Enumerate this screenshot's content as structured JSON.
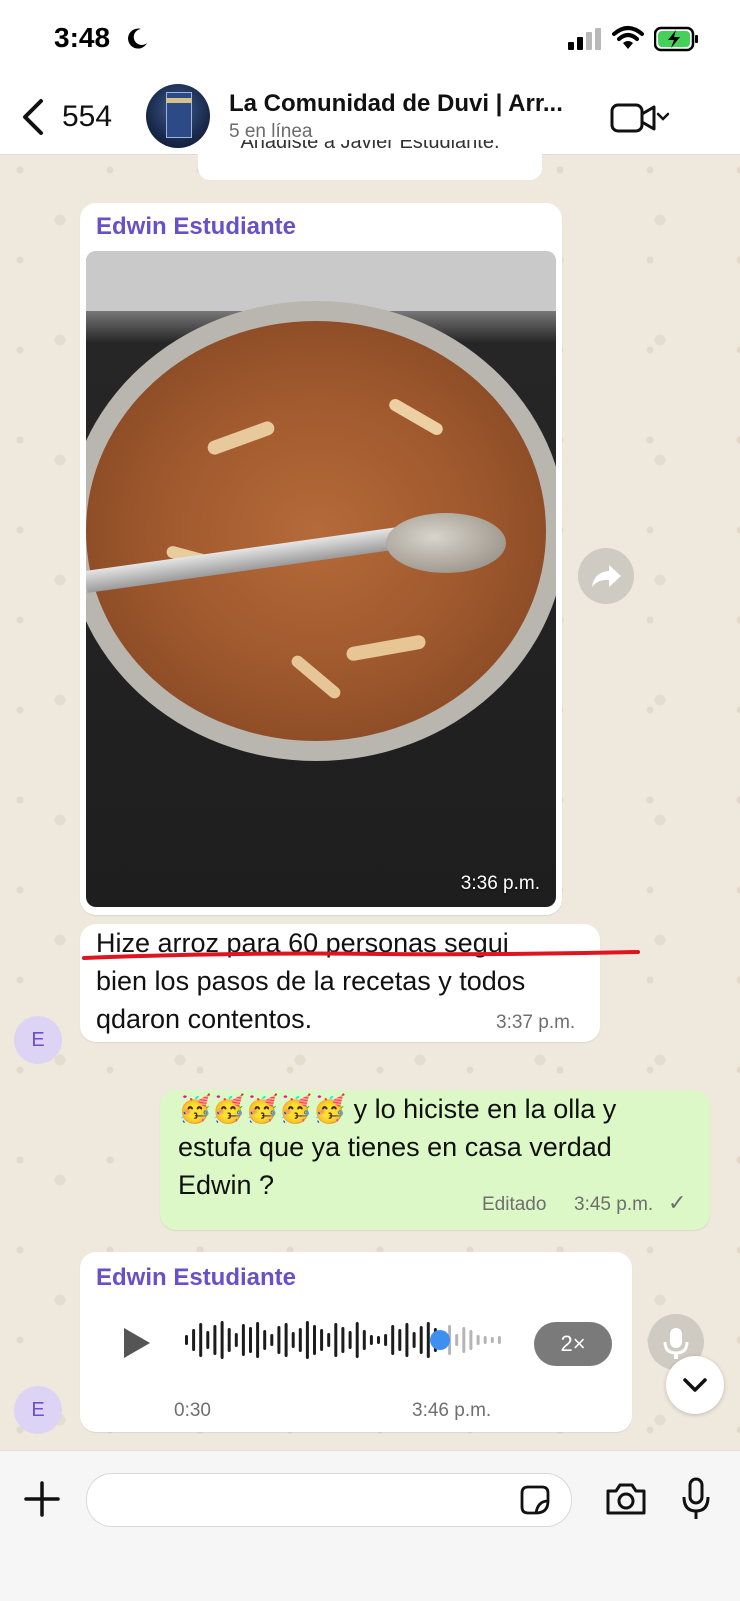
{
  "status_bar": {
    "time": "3:48"
  },
  "header": {
    "back_count": "554",
    "title": "La Comunidad de Duvi | Arr...",
    "subtitle": "5 en línea"
  },
  "system_notice": "Añadiste a Javier Estudiante.",
  "messages": {
    "photo_msg": {
      "sender": "Edwin Estudiante",
      "time": "3:36 p.m."
    },
    "text_msg": {
      "line1": "Hize arroz para 60  personas segui",
      "line2": "bien los pasos de la recetas y todos",
      "line3": "qdaron contentos.",
      "time": "3:37 p.m.",
      "avatar_initial": "E"
    },
    "outgoing": {
      "line1": "🥳🥳🥳🥳🥳 y lo hiciste en la olla y",
      "line2": "estufa que ya tienes en casa verdad",
      "line3": "Edwin ?",
      "edited": "Editado",
      "time": "3:45 p.m.",
      "check": "✓"
    },
    "voice": {
      "sender": "Edwin Estudiante",
      "duration": "0:30",
      "time": "3:46 p.m.",
      "speed": "2×",
      "progress": 0.82,
      "avatar_initial": "E"
    }
  },
  "colors": {
    "sender_name": "#6a50c7",
    "outgoing_bubble": "#dcf8c6",
    "highlight_line": "#e0141e",
    "waveform_played": "#1c1c1c",
    "waveform_unplayed": "#b5b5b5",
    "waveform_thumb": "#3d8ff0"
  },
  "icons": [
    "moon-icon",
    "signal-icon",
    "wifi-icon",
    "battery-icon",
    "back-icon",
    "video-call-icon",
    "forward-icon",
    "play-icon",
    "mic-icon",
    "chevron-down-icon",
    "plus-icon",
    "sticker-icon",
    "camera-icon"
  ]
}
